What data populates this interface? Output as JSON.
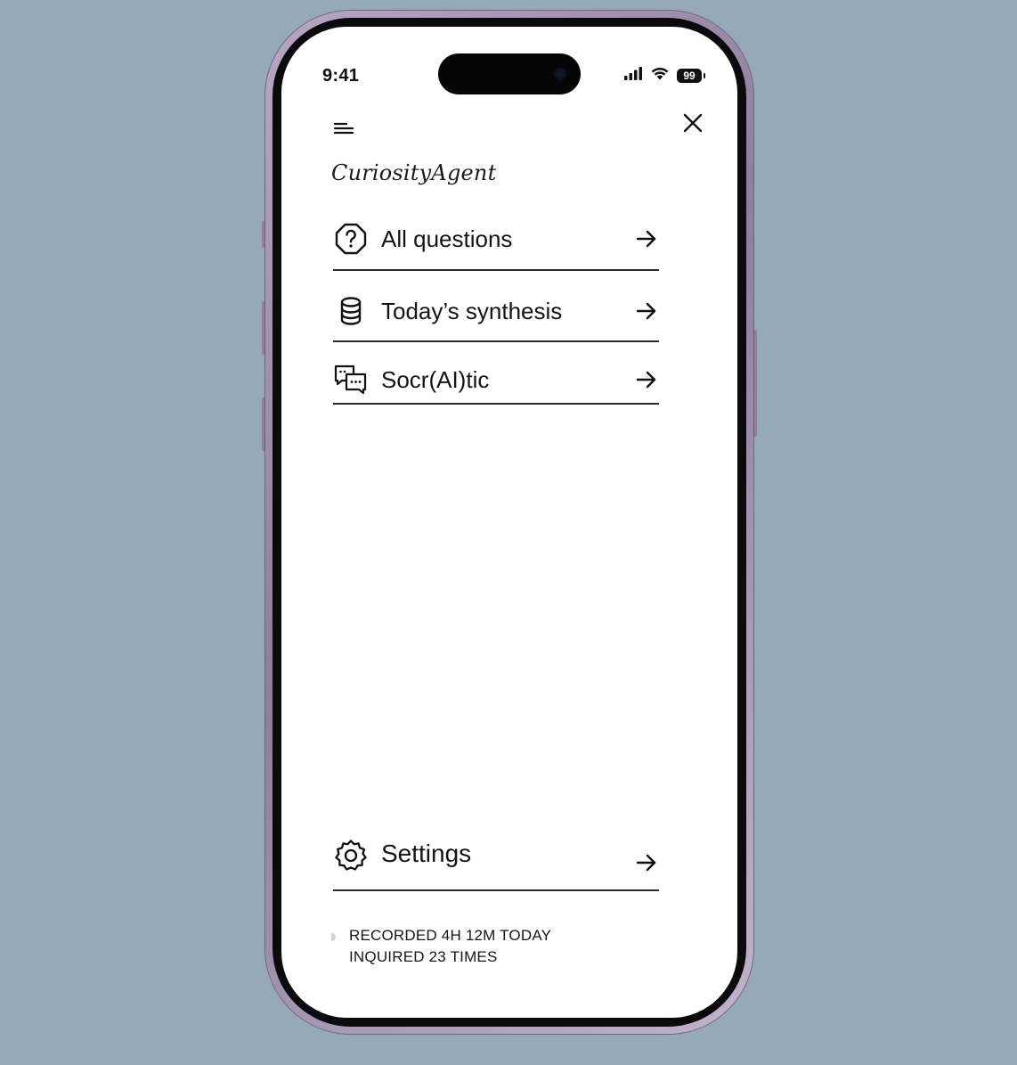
{
  "status_bar": {
    "time": "9:41",
    "battery": "99",
    "icons": [
      "signal-icon",
      "wifi-icon",
      "battery-icon"
    ]
  },
  "header": {
    "menu_icon": "menu-icon",
    "close_icon": "close-icon",
    "brand": "CuriosityAgent"
  },
  "nav": {
    "items": [
      {
        "label": "All questions",
        "icon": "question-octagon-icon"
      },
      {
        "label": "Today’s synthesis",
        "icon": "database-icon"
      },
      {
        "label": "Socr(AI)tic",
        "icon": "chat-bubbles-icon"
      }
    ],
    "settings": {
      "label": "Settings",
      "icon": "gear-icon"
    }
  },
  "stats": {
    "recorded": "RECORDED 4H 12M TODAY",
    "inquired": "INQUIRED 23 TIMES"
  },
  "colors": {
    "background": "#96a9b8",
    "phone_frame": "#8d7f9c",
    "screen": "#ffffff",
    "text": "#141414"
  }
}
